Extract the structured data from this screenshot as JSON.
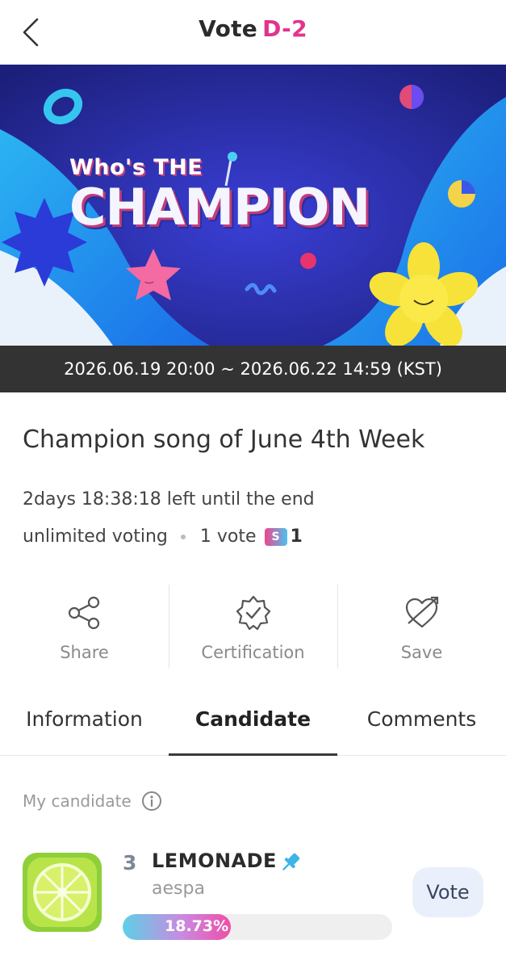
{
  "header": {
    "title": "Vote",
    "dday": "D-2"
  },
  "banner": {
    "small_title": "Who's THE",
    "big_title": "CHAMPION",
    "date_range": "2026.06.19 20:00 ~ 2026.06.22 14:59 (KST)"
  },
  "vote": {
    "title": "Champion song of June 4th Week",
    "time_left": "2days 18:38:18 left until the end",
    "voting_type": "unlimited voting",
    "per_vote": "1 vote",
    "ticket_icon_text": "S",
    "ticket_cost": "1"
  },
  "actions": [
    {
      "label": "Share",
      "icon": "share-icon"
    },
    {
      "label": "Certification",
      "icon": "certification-badge-icon"
    },
    {
      "label": "Save",
      "icon": "heart-arrow-icon"
    }
  ],
  "tabs": [
    {
      "label": "Information",
      "active": false
    },
    {
      "label": "Candidate",
      "active": true
    },
    {
      "label": "Comments",
      "active": false
    }
  ],
  "my_candidate": {
    "label": "My candidate",
    "rank": "3",
    "song": "LEMONADE",
    "artist": "aespa",
    "percent_text": "18.73%",
    "percent_value": 18.73,
    "vote_button": "Vote"
  },
  "colors": {
    "accent_pink": "#e2348c",
    "date_bar": "#333333",
    "vote_button_bg": "#eaf0fb"
  }
}
